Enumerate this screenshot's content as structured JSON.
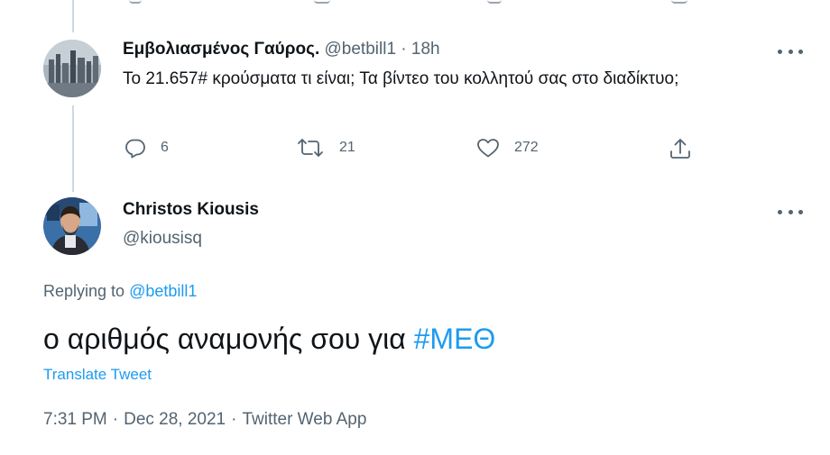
{
  "reply_tweet": {
    "display_name": "Εμβολιασμένος Γαύρος.",
    "handle": "@betbill1",
    "separator": "·",
    "time_ago": "18h",
    "text": "Το 21.657# κρούσματα τι είναι; Τα βίντεο του κολλητού σας στο διαδίκτυο;",
    "reply_count": "6",
    "retweet_count": "21",
    "like_count": "272"
  },
  "main_tweet": {
    "display_name": "Christos Kiousis",
    "handle": "@kiousisq",
    "replying_label": "Replying to",
    "replying_handle": "@betbill1",
    "text_plain": "ο αριθμός αναμονής σου για ",
    "hashtag": "#ΜΕΘ",
    "translate_label": "Translate Tweet",
    "time": "7:31 PM",
    "date": "Dec 28, 2021",
    "source": "Twitter Web App",
    "separator": "·"
  },
  "icons": {
    "reply": "reply-icon",
    "retweet": "retweet-icon",
    "like": "heart-icon",
    "share": "share-icon",
    "more": "more-icon"
  },
  "colors": {
    "link": "#1d9bf0",
    "muted": "#536471",
    "text": "#0f1419",
    "thread_line": "#cfd9de"
  }
}
